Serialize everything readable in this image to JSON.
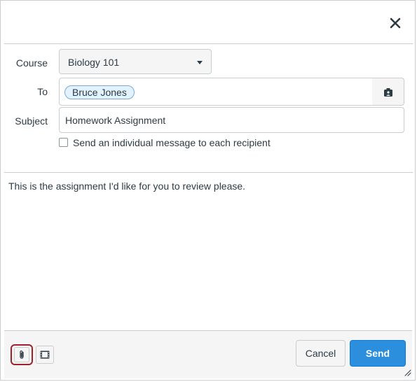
{
  "form": {
    "course_label": "Course",
    "course_value": "Biology 101",
    "to_label": "To",
    "recipient": "Bruce Jones",
    "subject_label": "Subject",
    "subject_value": "Homework Assignment",
    "individual_label": "Send an individual message to each recipient"
  },
  "message": {
    "body": "This is the assignment I'd like for you to review please."
  },
  "footer": {
    "cancel_label": "Cancel",
    "send_label": "Send"
  },
  "colors": {
    "accent": "#2b8fde",
    "highlight": "#a0212b",
    "token_bg": "#e3f2ff"
  },
  "icons": [
    "close-icon",
    "address-book-icon",
    "paperclip-icon",
    "media-icon",
    "resize-icon"
  ]
}
